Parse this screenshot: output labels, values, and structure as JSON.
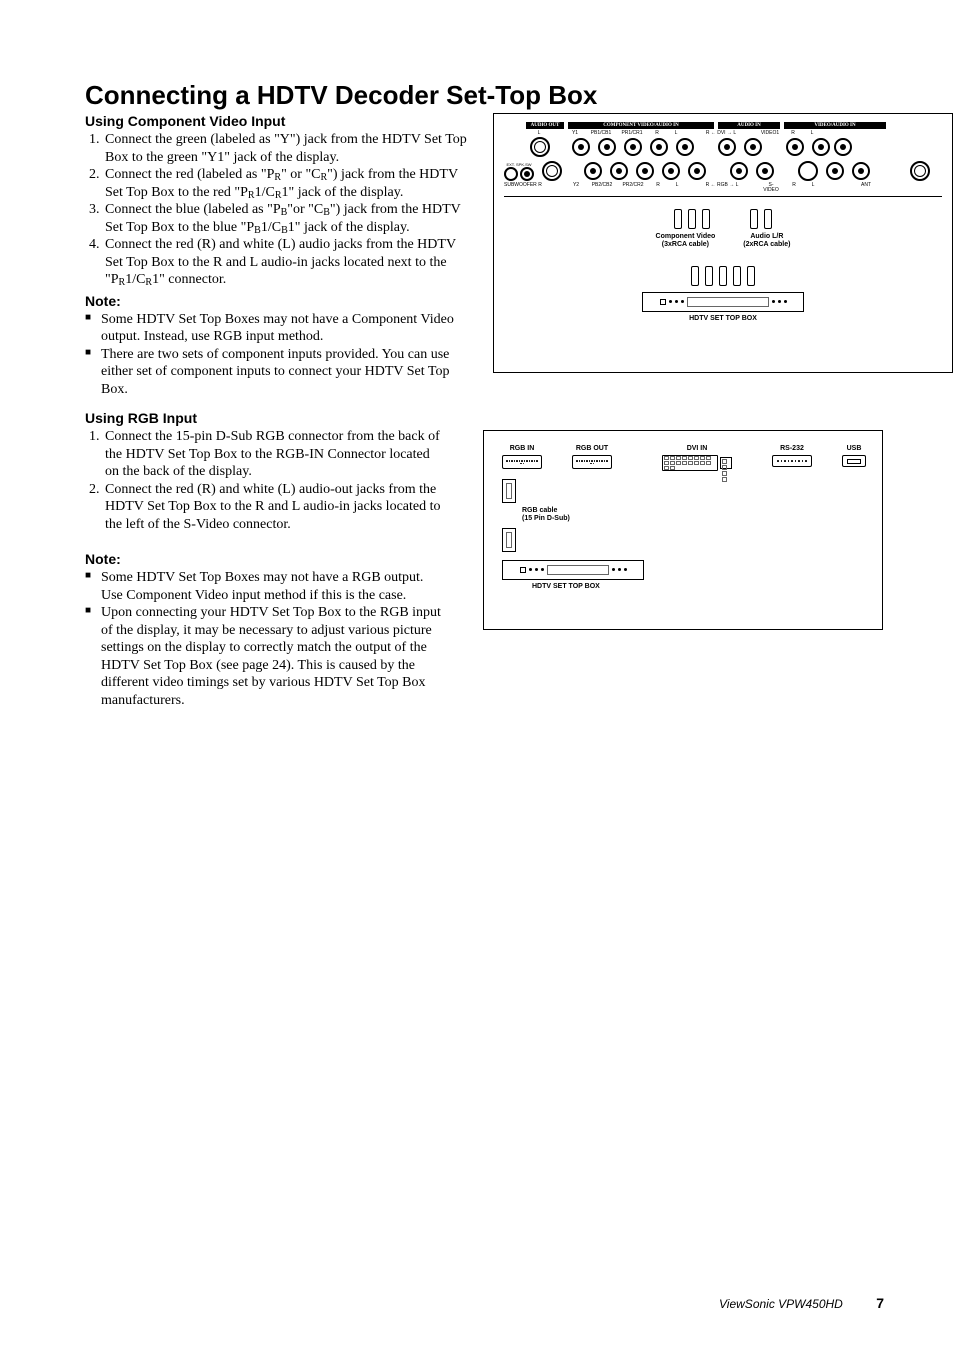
{
  "heading": "Connecting a HDTV Decoder Set-Top Box",
  "section1_title": "Using Component Video Input",
  "steps1": [
    "Connect the green (labeled as \"Y\") jack from the HDTV Set Top Box  to the green \"Y1\" jack of the display.",
    "Connect the red (labeled as \"P_R\" or \"C_R\") jack from the HDTV Set Top Box to the red \"P_R1/C_R1\" jack of the display.",
    "Connect the blue (labeled as \"P_B\"or \"C_B\") jack from the HDTV Set Top Box to the blue \"P_B1/C_B1\" jack of the display.",
    "Connect the red (R) and white (L) audio jacks from the HDTV Set Top Box to the R and L audio-in jacks located next to the \"P_R1/C_R1\" connector."
  ],
  "note_label": "Note:",
  "notes1": [
    "Some HDTV Set Top Boxes may not have a Component Video output.  Instead, use RGB input method.",
    "There are two sets of component inputs provided.  You can use either set of component inputs to connect your HDTV Set Top Box."
  ],
  "section2_title": "Using RGB Input",
  "steps2": [
    "Connect the 15-pin D-Sub RGB connector from the back of the HDTV Set Top Box to the RGB-IN Connector located on the back of the display.",
    "Connect the red (R) and white (L) audio-out jacks from the HDTV Set Top Box to the R and L audio-in jacks located to the left of the S-Video connector."
  ],
  "notes2": [
    "Some HDTV Set Top Boxes may not have a RGB output.  Use Component Video input method if this is the case.",
    "Upon connecting your HDTV Set Top Box to the RGB input of the display, it may be necessary to adjust various picture settings on the display to correctly match the output of the HDTV Set Top Box (see page 24).  This is caused by the different video timings set by various HDTV Set Top Box manufacturers."
  ],
  "diagram1": {
    "headers": [
      "AUDIO OUT",
      "COMPONENT VIDEO/AUDIO IN",
      "AUDIO IN",
      "VIDEO/AUDIO IN"
    ],
    "top_labels": [
      "L",
      "Y1",
      "PB1/CB1",
      "PR1/CR1",
      "R",
      "L",
      "R ← DVI → L",
      "VIDEO1",
      "R",
      "L"
    ],
    "second_row_left_labels": [
      "EXT. SPK.SW",
      "SUBWOOFER",
      "R",
      "Y2",
      "PB2/CB2",
      "PR2/CR2",
      "R",
      "L",
      "R ← RGB → L",
      "S-VIDEO",
      "R",
      "L",
      "ANT"
    ],
    "cable1": "Component Video\n(3xRCA cable)",
    "cable2": "Audio L/R\n(2xRCA cable)",
    "stb": "HDTV SET TOP BOX"
  },
  "diagram2": {
    "ports": [
      "RGB IN",
      "RGB OUT",
      "DVI  IN",
      "RS-232",
      "USB"
    ],
    "cable": "RGB cable\n(15 Pin D-Sub)",
    "stb": "HDTV SET TOP BOX"
  },
  "footer_product": "ViewSonic  VPW450HD",
  "footer_page": "7"
}
